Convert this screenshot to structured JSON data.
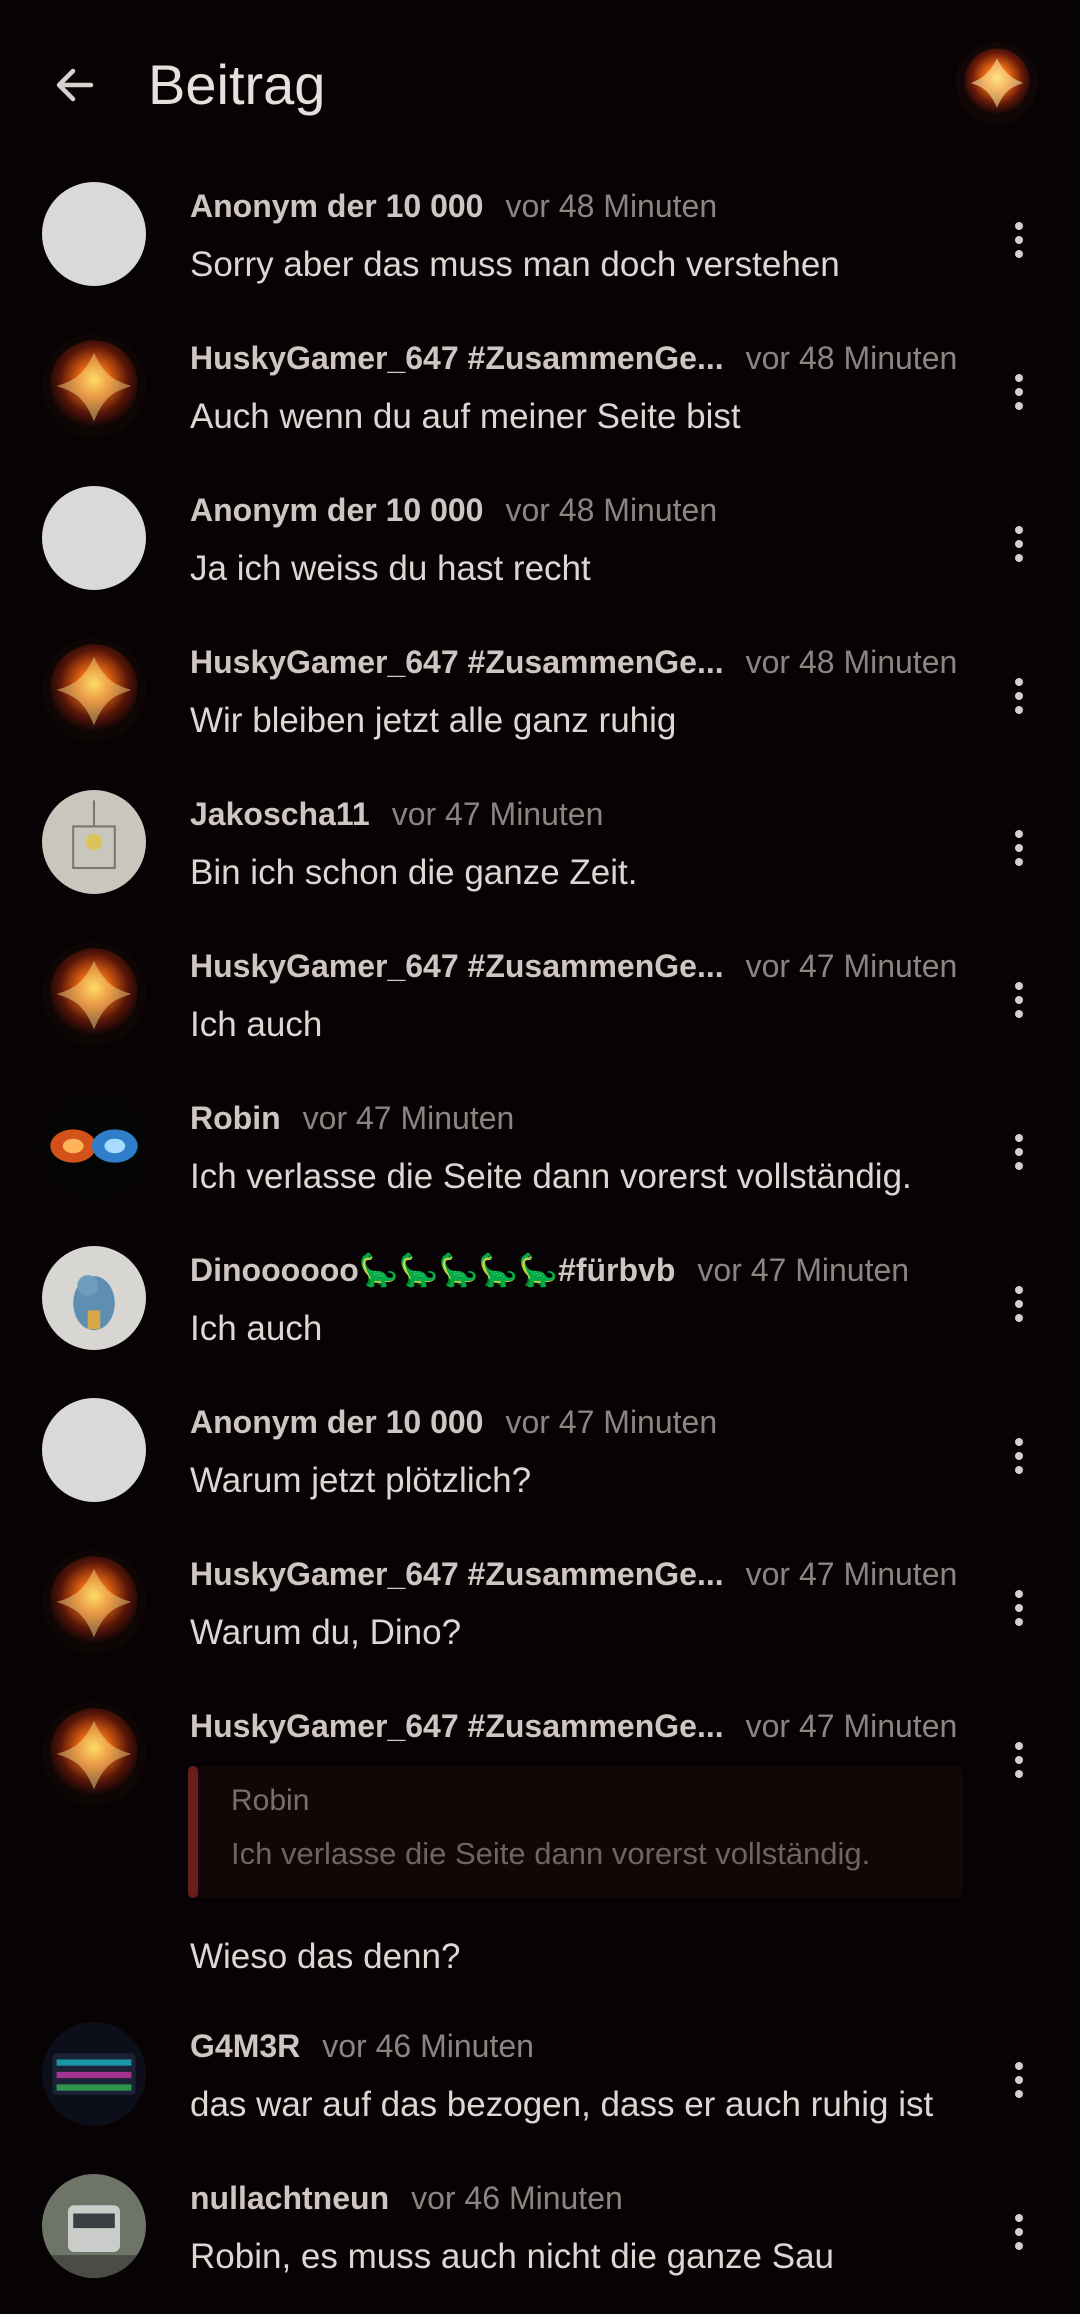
{
  "header": {
    "title": "Beitrag",
    "back_icon": "arrow-left-icon",
    "avatar_icon": "phoenix-avatar"
  },
  "comments": [
    {
      "author": "Anonym der 10 000",
      "time": "vor 48 Minuten",
      "text": "Sorry aber das muss man doch verstehen",
      "avatar": "blank"
    },
    {
      "author": "HuskyGamer_647 #ZusammenGe...",
      "time": "vor 48 Minuten",
      "text": "Auch wenn du auf meiner Seite bist",
      "avatar": "phoenix"
    },
    {
      "author": "Anonym der 10 000",
      "time": "vor 48 Minuten",
      "text": "Ja ich weiss du hast recht",
      "avatar": "blank"
    },
    {
      "author": "HuskyGamer_647 #ZusammenGe...",
      "time": "vor 48 Minuten",
      "text": "Wir bleiben jetzt alle ganz ruhig",
      "avatar": "phoenix"
    },
    {
      "author": "Jakoscha11",
      "time": "vor 47 Minuten",
      "text": "Bin ich schon die ganze Zeit.",
      "avatar": "sketch"
    },
    {
      "author": "HuskyGamer_647 #ZusammenGe...",
      "time": "vor 47 Minuten",
      "text": "Ich auch",
      "avatar": "phoenix"
    },
    {
      "author": "Robin",
      "time": "vor 47 Minuten",
      "text": "Ich verlasse die Seite dann vorerst vollständig.",
      "avatar": "fire-ice"
    },
    {
      "author": "Dinoooooo🦕🦕🦕🦕🦕#fürbvb",
      "time": "vor 47 Minuten",
      "text": "Ich auch",
      "avatar": "dino"
    },
    {
      "author": "Anonym der 10 000",
      "time": "vor 47 Minuten",
      "text": "Warum jetzt plötzlich?",
      "avatar": "blank"
    },
    {
      "author": "HuskyGamer_647 #ZusammenGe...",
      "time": "vor 47 Minuten",
      "text": "Warum du, Dino?",
      "avatar": "phoenix"
    },
    {
      "author": "HuskyGamer_647 #ZusammenGe...",
      "time": "vor 47 Minuten",
      "text": "Wieso das denn?",
      "avatar": "phoenix",
      "quote": {
        "author": "Robin",
        "text": "Ich verlasse die Seite dann vorerst vollständig."
      }
    },
    {
      "author": "G4M3R",
      "time": "vor 46 Minuten",
      "text": "das war auf das bezogen, dass er auch ruhig ist",
      "avatar": "keyboard"
    },
    {
      "author": "nullachtneun",
      "time": "vor 46 Minuten",
      "text": "Robin, es muss auch nicht die ganze Sau",
      "avatar": "train"
    }
  ],
  "colors": {
    "background": "#070203",
    "quote_bar": "#6a1d1a",
    "author": "#cfc5c2",
    "time": "#8d8482"
  },
  "icons": {
    "menu": "more-vertical-icon"
  }
}
